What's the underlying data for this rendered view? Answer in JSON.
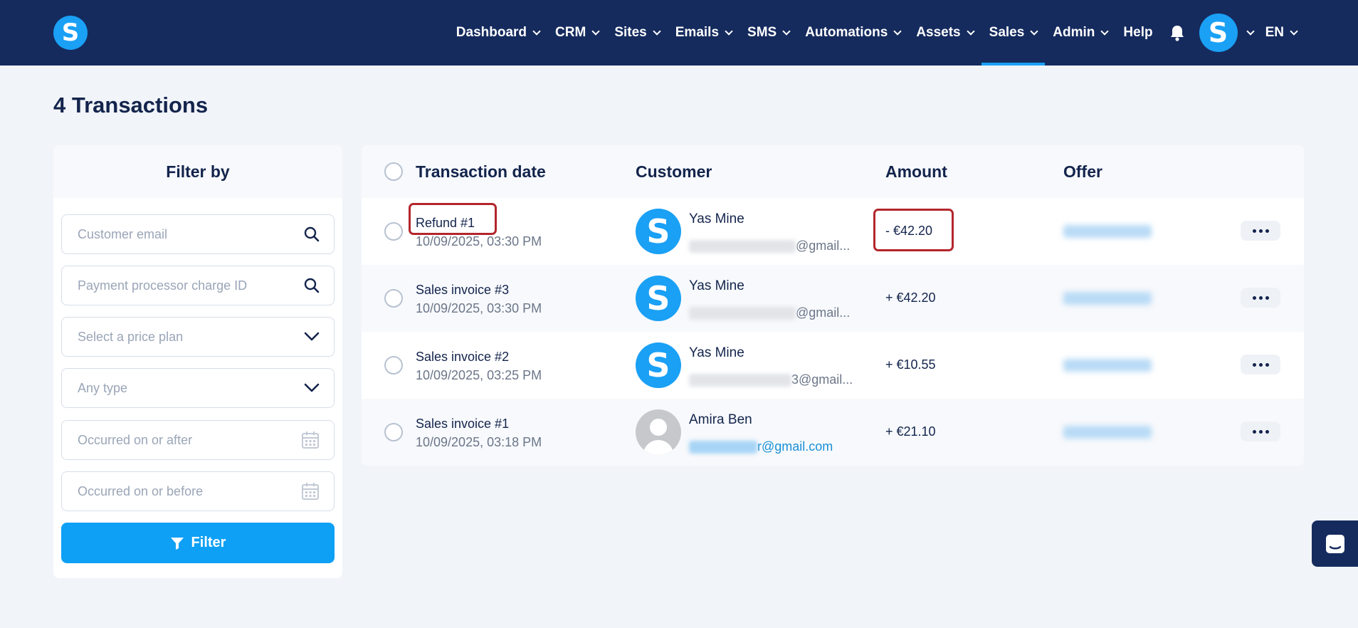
{
  "brand": {
    "logo_letter": "S",
    "accent": "#1aa0f5",
    "nav_bg": "#152b5e"
  },
  "nav": {
    "items": [
      {
        "label": "Dashboard",
        "dropdown": true
      },
      {
        "label": "CRM",
        "dropdown": true
      },
      {
        "label": "Sites",
        "dropdown": true
      },
      {
        "label": "Emails",
        "dropdown": true
      },
      {
        "label": "SMS",
        "dropdown": true
      },
      {
        "label": "Automations",
        "dropdown": true
      },
      {
        "label": "Assets",
        "dropdown": true
      },
      {
        "label": "Sales",
        "dropdown": true,
        "active": true
      },
      {
        "label": "Admin",
        "dropdown": true
      },
      {
        "label": "Help",
        "dropdown": false
      }
    ],
    "avatar_letter": "S",
    "language": "EN"
  },
  "page": {
    "title": "4 Transactions"
  },
  "filter": {
    "heading": "Filter by",
    "customer_email_placeholder": "Customer email",
    "charge_id_placeholder": "Payment processor charge ID",
    "price_plan_placeholder": "Select a price plan",
    "type_placeholder": "Any type",
    "after_placeholder": "Occurred on or after",
    "before_placeholder": "Occurred on or before",
    "button_label": "Filter"
  },
  "table": {
    "columns": {
      "date": "Transaction date",
      "customer": "Customer",
      "amount": "Amount",
      "offer": "Offer"
    },
    "rows": [
      {
        "title": "Refund #1",
        "date": "10/09/2025, 03:30 PM",
        "avatar": "S",
        "name": "Yas Mine",
        "email_suffix": "@gmail...",
        "amount": "- €42.20"
      },
      {
        "title": "Sales invoice #3",
        "date": "10/09/2025, 03:30 PM",
        "avatar": "S",
        "name": "Yas Mine",
        "email_suffix": "@gmail...",
        "amount": "+ €42.20"
      },
      {
        "title": "Sales invoice #2",
        "date": "10/09/2025, 03:25 PM",
        "avatar": "S",
        "name": "Yas Mine",
        "email_suffix": "3@gmail...",
        "amount": "+ €10.55"
      },
      {
        "title": "Sales invoice #1",
        "date": "10/09/2025, 03:18 PM",
        "avatar": "",
        "name": "Amira Ben",
        "email_suffix": "r@gmail.com",
        "amount": "+ €21.10"
      }
    ]
  },
  "highlight_color": "#b3262c"
}
